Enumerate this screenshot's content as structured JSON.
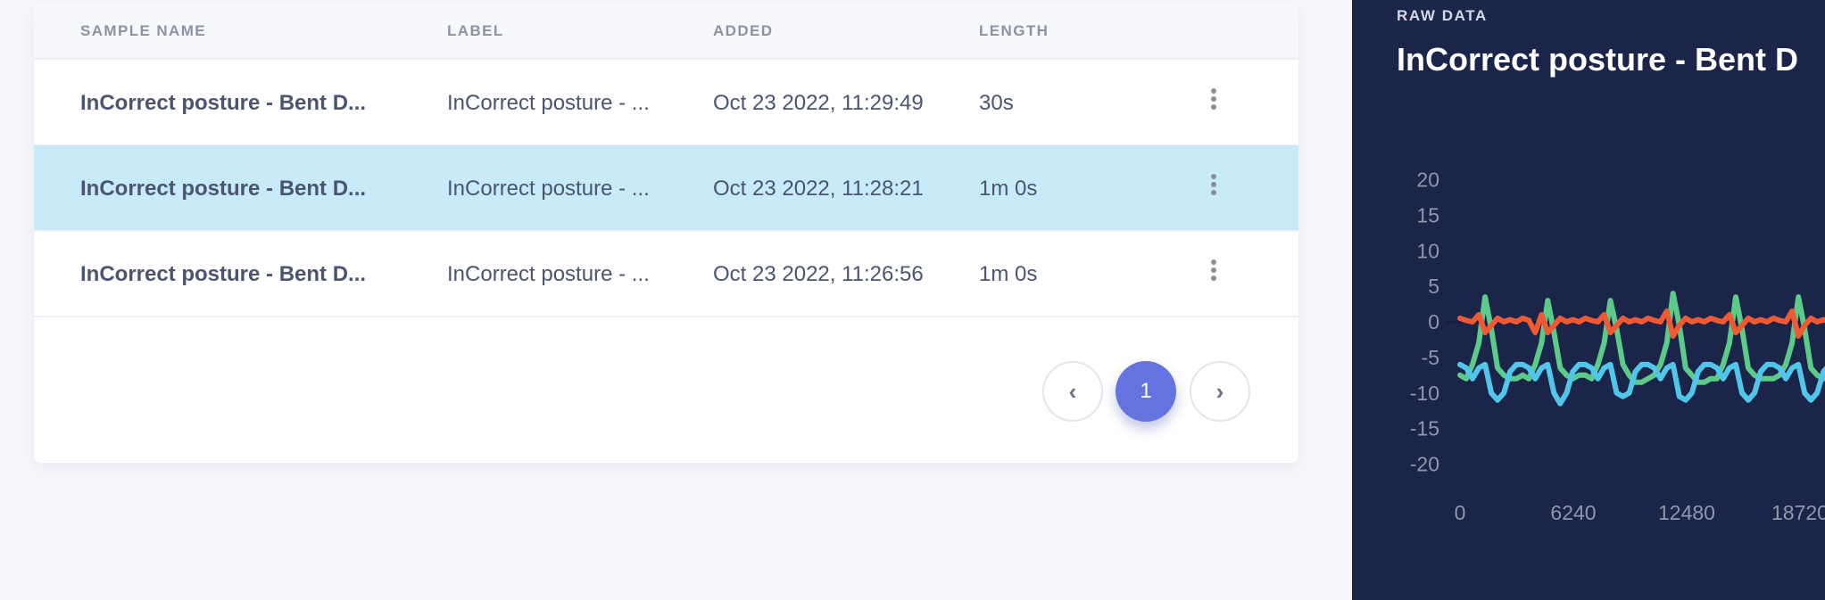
{
  "table": {
    "columns": [
      "SAMPLE NAME",
      "LABEL",
      "ADDED",
      "LENGTH"
    ],
    "rows": [
      {
        "name": "InCorrect posture - Bent D...",
        "label": "InCorrect posture - ...",
        "added": "Oct 23 2022, 11:29:49",
        "length": "30s",
        "selected": false
      },
      {
        "name": "InCorrect posture - Bent D...",
        "label": "InCorrect posture - ...",
        "added": "Oct 23 2022, 11:28:21",
        "length": "1m 0s",
        "selected": true
      },
      {
        "name": "InCorrect posture - Bent D...",
        "label": "InCorrect posture - ...",
        "added": "Oct 23 2022, 11:26:56",
        "length": "1m 0s",
        "selected": false
      }
    ],
    "row_menu_icon": "more-vertical-icon",
    "selected_color": "#c7ecf7"
  },
  "pagination": {
    "prev_icon": "chevron-left-icon",
    "current_page": "1",
    "next_icon": "chevron-right-icon",
    "accent": "#6573e0"
  },
  "raw_data": {
    "section_label": "RAW DATA",
    "title": "InCorrect posture - Bent D",
    "background": "#1b2449"
  },
  "chart_data": {
    "type": "line",
    "ylim": [
      -20,
      20
    ],
    "yticks": [
      "20",
      "15",
      "10",
      "5",
      "0",
      "-5",
      "-10",
      "-15",
      "-20"
    ],
    "xticks": [
      "0",
      "6240",
      "12480",
      "18720"
    ],
    "grid": false,
    "x": [
      0,
      345,
      690,
      1035,
      1380,
      1725,
      2070,
      2415,
      2760,
      3105,
      3450,
      3795,
      4140,
      4485,
      4830,
      5175,
      5520,
      5865,
      6210,
      6555,
      6900,
      7245,
      7590,
      7935,
      8280,
      8625,
      8970,
      9315,
      9660,
      10005,
      10350,
      10695,
      11040,
      11385,
      11730,
      12075,
      12420,
      12765,
      13110,
      13455,
      13800,
      14145,
      14490,
      14835,
      15180,
      15525,
      15870,
      16215,
      16560,
      16905,
      17250,
      17595,
      17940,
      18285,
      18630,
      18975,
      19320,
      19665,
      20010,
      20355
    ],
    "series": [
      {
        "color": "#5ccb89",
        "values": [
          -7.5,
          -8,
          -6,
          -3,
          3.5,
          -1,
          -6.5,
          -7.5,
          -8,
          -8,
          -7.5,
          -8,
          -6,
          -3,
          3,
          -1.5,
          -6.5,
          -7.5,
          -8,
          -7.5,
          -7.5,
          -8,
          -6,
          -3,
          3,
          -1,
          -6,
          -7.5,
          -8.5,
          -8.5,
          -8,
          -7.5,
          -6,
          -3,
          4,
          -0.5,
          -6.5,
          -7.5,
          -8.5,
          -8.5,
          -8,
          -8,
          -6,
          -3,
          3.5,
          -1,
          -6.5,
          -7.5,
          -8,
          -8,
          -8,
          -7.5,
          -6,
          -3,
          3.5,
          -1,
          -6.5,
          -7.5,
          -8,
          -8
        ]
      },
      {
        "color": "#52c6ea",
        "values": [
          -6,
          -6.5,
          -8,
          -6.5,
          -6,
          -10,
          -11,
          -10,
          -7,
          -6,
          -6,
          -6.5,
          -8,
          -6.5,
          -6,
          -10,
          -11.5,
          -10,
          -7,
          -6,
          -6,
          -6.5,
          -8,
          -6.5,
          -6,
          -10,
          -10.5,
          -10,
          -7,
          -6,
          -6,
          -6.5,
          -8,
          -6.5,
          -6,
          -10.5,
          -11,
          -10,
          -7,
          -6,
          -6,
          -6.5,
          -8,
          -6.5,
          -6,
          -10,
          -11,
          -10,
          -7,
          -6,
          -6,
          -6.5,
          -8,
          -6.5,
          -6,
          -10,
          -11,
          -10,
          -7,
          -6
        ]
      },
      {
        "color": "#ef5a35",
        "values": [
          0.5,
          0.2,
          0,
          1,
          -1.5,
          -0.5,
          0.5,
          0,
          0.3,
          0,
          0.5,
          0.2,
          -1.5,
          1,
          -1.5,
          -0.5,
          0.5,
          0,
          0.3,
          0,
          0.5,
          0.2,
          0,
          1,
          -1.5,
          -0.5,
          0.5,
          0,
          0.3,
          0,
          0.5,
          0.2,
          0,
          1.5,
          -2,
          -0.5,
          0.5,
          0,
          0.3,
          0,
          0.5,
          0.2,
          0,
          1,
          -1.5,
          -0.5,
          0.5,
          0,
          0.3,
          0,
          0.5,
          0.2,
          0,
          1.5,
          -2,
          -0.5,
          0.5,
          0,
          0.3,
          0
        ]
      }
    ]
  }
}
